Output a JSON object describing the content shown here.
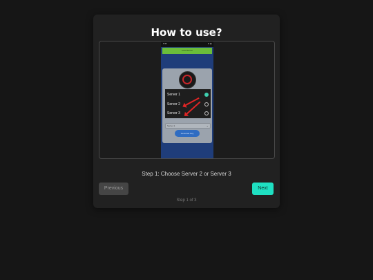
{
  "modal": {
    "title": "How to use?",
    "step_text": "Step 1: Choose Server 2 or Server 3",
    "step_count": "Step 1 of 3",
    "prev_label": "Previous",
    "next_label": "Next"
  },
  "phone": {
    "status_time": "9:41",
    "status_icons": "▲ ▮",
    "top_button_label": "Load Server",
    "servers": [
      {
        "label": "Server 1",
        "selected": true
      },
      {
        "label": "Server 2",
        "selected": false
      },
      {
        "label": "Server 3",
        "selected": false
      }
    ],
    "select_label": "Server 1",
    "generate_label": "Generate Key"
  },
  "colors": {
    "background": "#161616",
    "modal": "#212121",
    "accent": "#1fe0c2",
    "arrow": "#e02525"
  }
}
